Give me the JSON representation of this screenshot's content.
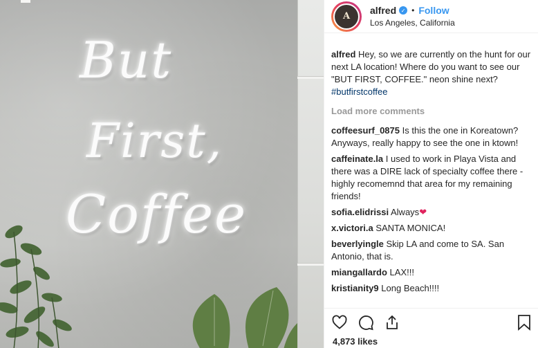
{
  "photo": {
    "neon_lines": [
      "But",
      "First,",
      "Coffee"
    ]
  },
  "post_header": {
    "avatar_text": "A",
    "username": "alfred",
    "verified_icon": "verified-check-icon",
    "separator": "•",
    "follow_label": "Follow",
    "location": "Los Angeles, California"
  },
  "caption": {
    "username": "alfred",
    "text": "Hey, so we are currently on the hunt for our next LA location! Where do you want to see our \"BUT FIRST, COFFEE.\" neon shine next? ",
    "hashtag": "#butfirstcoffee"
  },
  "load_more": "Load more comments",
  "comments": [
    {
      "username": "coffeesurf_0875",
      "text": "Is this the one in Koreatown? Anyways, really happy to see the one in ktown!"
    },
    {
      "username": "caffeinate.la",
      "text": "I used to work in Playa Vista and there was a DIRE lack of specialty coffee there - highly recomemnd that area for my remaining friends!"
    },
    {
      "username": "sofia.elidrissi",
      "text": "Always",
      "emoji": "❤"
    },
    {
      "username": "x.victori.a",
      "text": "SANTA MONICA!"
    },
    {
      "username": "beverlyingle",
      "text": "Skip LA and come to SA. San Antonio, that is."
    },
    {
      "username": "miangallardo",
      "text": "LAX!!!"
    },
    {
      "username": "kristianity9",
      "text": "Long Beach!!!!"
    }
  ],
  "actions": {
    "icons": [
      "heart-icon",
      "comment-icon",
      "share-icon",
      "bookmark-icon"
    ],
    "likes": "4,873 likes"
  },
  "colors": {
    "link": "#3897f0",
    "hashtag": "#003569",
    "muted": "#999999",
    "text": "#262626"
  }
}
